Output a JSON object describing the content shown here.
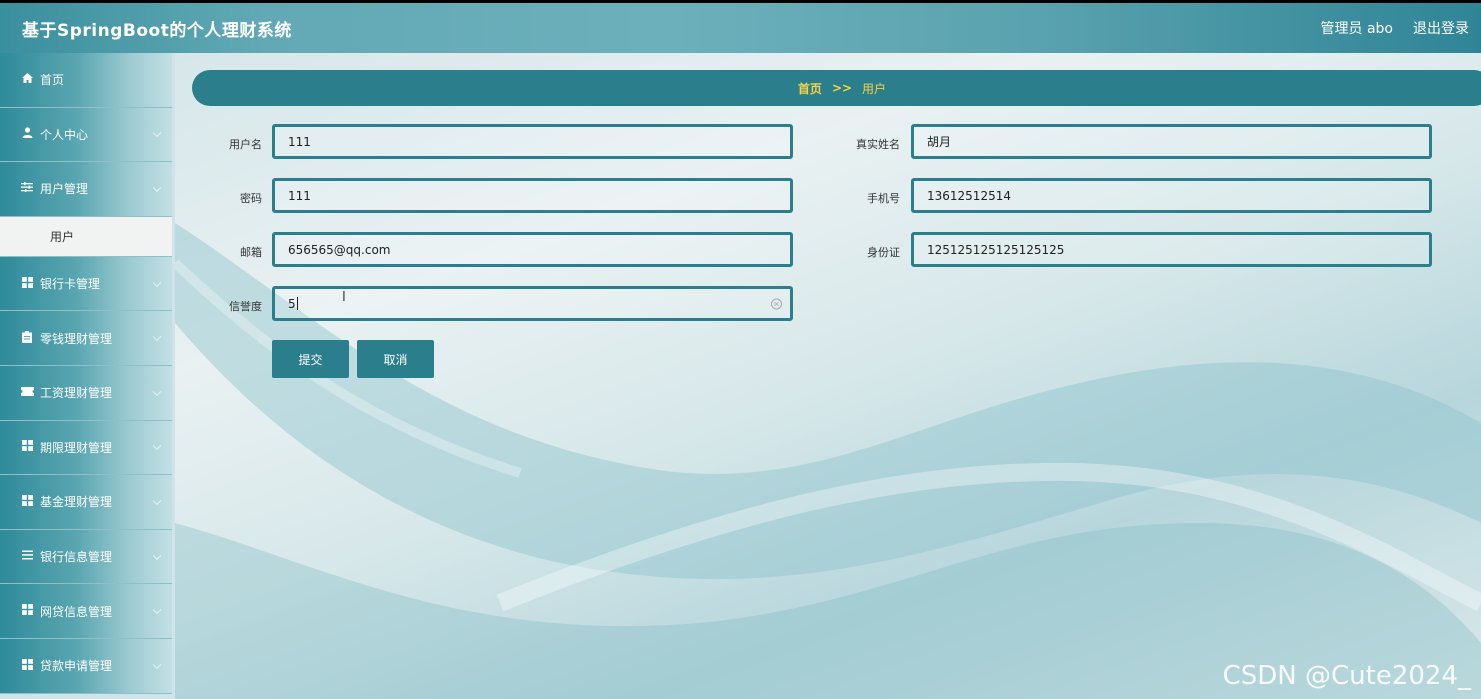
{
  "header": {
    "title": "基于SpringBoot的个人理财系统",
    "user_label": "管理员 abo",
    "logout_label": "退出登录"
  },
  "sidebar": {
    "items": [
      {
        "label": "首页",
        "icon": "home-icon"
      },
      {
        "label": "个人中心",
        "icon": "user-icon"
      },
      {
        "label": "用户管理",
        "icon": "sliders-icon"
      },
      {
        "label": "银行卡管理",
        "icon": "grid-icon"
      },
      {
        "label": "零钱理财管理",
        "icon": "clipboard-icon"
      },
      {
        "label": "工资理财管理",
        "icon": "ticket-icon"
      },
      {
        "label": "期限理财管理",
        "icon": "grid-icon"
      },
      {
        "label": "基金理财管理",
        "icon": "grid-icon"
      },
      {
        "label": "银行信息管理",
        "icon": "list-icon"
      },
      {
        "label": "网贷信息管理",
        "icon": "grid-icon"
      },
      {
        "label": "贷款申请管理",
        "icon": "grid-icon"
      }
    ],
    "sub_item": "用户"
  },
  "breadcrumb": {
    "home": "首页",
    "separator": ">>",
    "current": "用户"
  },
  "form": {
    "username_label": "用户名",
    "username_value": "111",
    "realname_label": "真实姓名",
    "realname_value": "胡月",
    "password_label": "密码",
    "password_value": "111",
    "phone_label": "手机号",
    "phone_value": "13612512514",
    "email_label": "邮箱",
    "email_value": "656565@qq.com",
    "idcard_label": "身份证",
    "idcard_value": "125125125125125125",
    "credit_label": "信誉度",
    "credit_value": "5",
    "submit_label": "提交",
    "cancel_label": "取消"
  },
  "watermark": "CSDN @Cute2024_",
  "colors": {
    "accent": "#2b7f8c",
    "breadcrumb_text": "#f3d34a"
  }
}
